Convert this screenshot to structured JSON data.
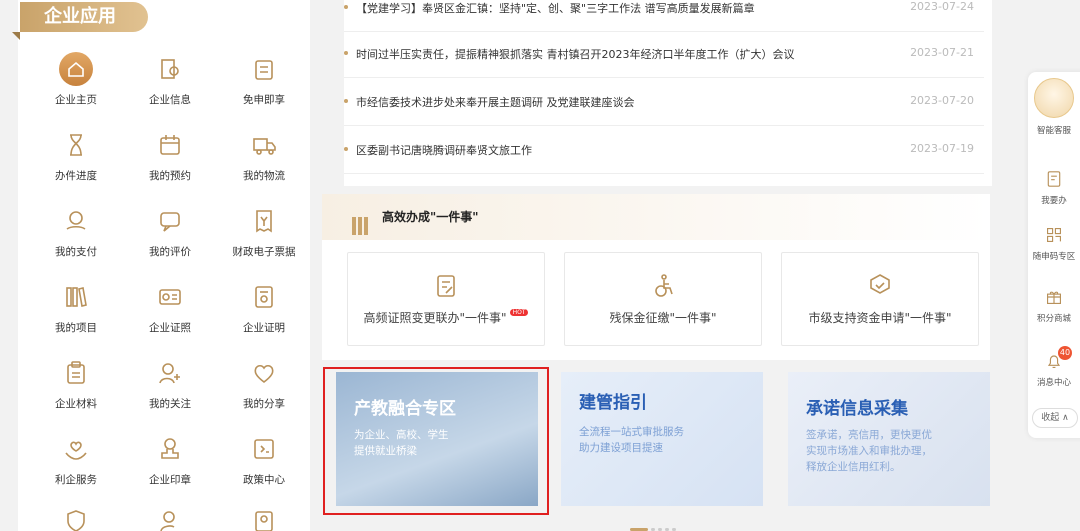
{
  "sidebar": {
    "title": "企业应用",
    "items": [
      {
        "label": "企业主页",
        "icon": "home-icon"
      },
      {
        "label": "企业信息",
        "icon": "enterprise-info-icon"
      },
      {
        "label": "免申即享",
        "icon": "no-apply-icon"
      },
      {
        "label": "办件进度",
        "icon": "hourglass-icon"
      },
      {
        "label": "我的预约",
        "icon": "calendar-icon"
      },
      {
        "label": "我的物流",
        "icon": "truck-icon"
      },
      {
        "label": "我的支付",
        "icon": "payment-icon"
      },
      {
        "label": "我的评价",
        "icon": "comment-icon"
      },
      {
        "label": "财政电子票据",
        "icon": "receipt-icon"
      },
      {
        "label": "我的项目",
        "icon": "books-icon"
      },
      {
        "label": "企业证照",
        "icon": "license-icon"
      },
      {
        "label": "企业证明",
        "icon": "certificate-icon"
      },
      {
        "label": "企业材料",
        "icon": "clipboard-icon"
      },
      {
        "label": "我的关注",
        "icon": "follow-user-icon"
      },
      {
        "label": "我的分享",
        "icon": "heart-share-icon"
      },
      {
        "label": "利企服务",
        "icon": "hand-heart-icon"
      },
      {
        "label": "企业印章",
        "icon": "seal-icon"
      },
      {
        "label": "政策中心",
        "icon": "policy-book-icon"
      },
      {
        "label": "",
        "icon": "shield-icon"
      },
      {
        "label": "",
        "icon": "user-edit-icon"
      },
      {
        "label": "",
        "icon": "id-card-icon"
      }
    ]
  },
  "news": [
    {
      "title": "【党建学习】奉贤区金汇镇：坚持\"定、创、聚\"三字工作法 谱写高质量发展新篇章",
      "date": "2023-07-24"
    },
    {
      "title": "时间过半压实责任，提振精神狠抓落实 青村镇召开2023年经济口半年度工作（扩大）会议",
      "date": "2023-07-21"
    },
    {
      "title": "市经信委技术进步处来奉开展主题调研 及党建联建座谈会",
      "date": "2023-07-20"
    },
    {
      "title": "区委副书记唐晓腾调研奉贤文旅工作",
      "date": "2023-07-19"
    }
  ],
  "one_thing": {
    "title": "高效办成\"一件事\"",
    "cards": [
      {
        "label": "高频证照变更联办\"一件事\"",
        "badge": "HOT",
        "icon": "edit-doc-icon"
      },
      {
        "label": "残保金征缴\"一件事\"",
        "icon": "disabled-icon"
      },
      {
        "label": "市级支持资金申请\"一件事\"",
        "icon": "award-icon"
      }
    ]
  },
  "banners": [
    {
      "title": "产教融合专区",
      "sub1": "为企业、高校、学生",
      "sub2": "提供就业桥梁"
    },
    {
      "title": "建管指引",
      "sub1": "全流程一站式审批服务",
      "sub2": "助力建设项目提速"
    },
    {
      "title": "承诺信息采集",
      "sub1": "签承诺，亮信用，更快更优",
      "sub2": "实现市场准入和审批办理，",
      "sub3": "释放企业信用红利。"
    }
  ],
  "right_panel": {
    "items": [
      {
        "label": "智能客服"
      },
      {
        "label": "我要办"
      },
      {
        "label": "随申码专区"
      },
      {
        "label": "积分商城"
      },
      {
        "label": "消息中心",
        "badge": "40"
      }
    ],
    "collapse": "收起 ∧"
  },
  "colors": {
    "accent": "#c9a36a",
    "highlight": "#e02020",
    "link_blue": "#2a5fb4"
  }
}
